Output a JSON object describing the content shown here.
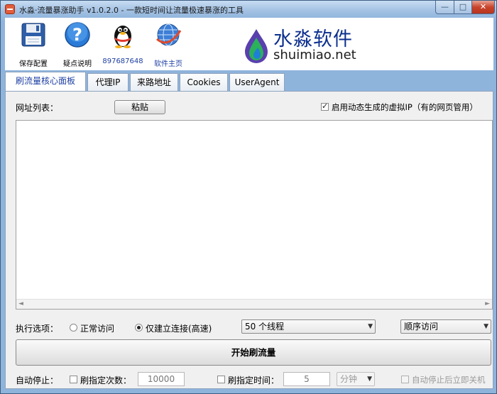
{
  "window": {
    "title": "水淼·流量暴涨助手 v1.0.2.0 - 一款短时间让流量极速暴涨的工具",
    "buttons": {
      "minimize": "—",
      "maximize": "□",
      "close": "✕"
    }
  },
  "toolbar": {
    "items": [
      {
        "label": "保存配置",
        "icon": "floppy-disk-icon"
      },
      {
        "label": "疑点说明",
        "icon": "help-question-icon"
      },
      {
        "label": "897687648",
        "icon": "qq-penguin-icon"
      },
      {
        "label": "软件主页",
        "icon": "globe-icon"
      }
    ],
    "logo_cn": "水淼软件",
    "logo_en": "shuimiao.net"
  },
  "tabs": [
    {
      "label": "刷流量核心面板",
      "active": true
    },
    {
      "label": "代理IP"
    },
    {
      "label": "来路地址"
    },
    {
      "label": "Cookies"
    },
    {
      "label": "UserAgent"
    }
  ],
  "panel": {
    "url_list_label": "网址列表：",
    "paste_button": "粘贴",
    "dynamic_ip_checkbox": "启用动态生成的虚拟IP（有的网页管用）",
    "url_list_value": "",
    "exec_options_label": "执行选项：",
    "radio_normal": "正常访问",
    "radio_connect_only": "仅建立连接(高速)",
    "threads_select": "50 个线程",
    "order_select": "顺序访问",
    "start_button": "开始刷流量",
    "auto_stop_label": "自动停止：",
    "stop_count_checkbox": "刷指定次数：",
    "stop_count_value": "10000",
    "stop_time_checkbox": "刷指定时间：",
    "stop_time_value": "5",
    "time_unit_select": "分钟",
    "shutdown_checkbox": "自动停止后立即关机"
  }
}
